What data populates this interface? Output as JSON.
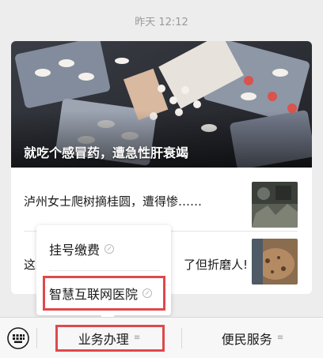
{
  "chat": {
    "timestamp": "昨天 12:12"
  },
  "article": {
    "cover_title": "就吃个感冒药，遭急性肝衰竭",
    "items": [
      {
        "title": "泸州女士爬树摘桂圆，遭得惨……"
      },
      {
        "title_left": "这",
        "title_right": "了但折磨人!"
      }
    ]
  },
  "popup_menu": {
    "items": [
      {
        "label": "挂号缴费"
      },
      {
        "label": "智慧互联网医院"
      }
    ]
  },
  "bottom_menu": {
    "items": [
      {
        "label": "业务办理"
      },
      {
        "label": "便民服务"
      }
    ]
  },
  "colors": {
    "highlight": "#e0484c",
    "background": "#ededed"
  }
}
